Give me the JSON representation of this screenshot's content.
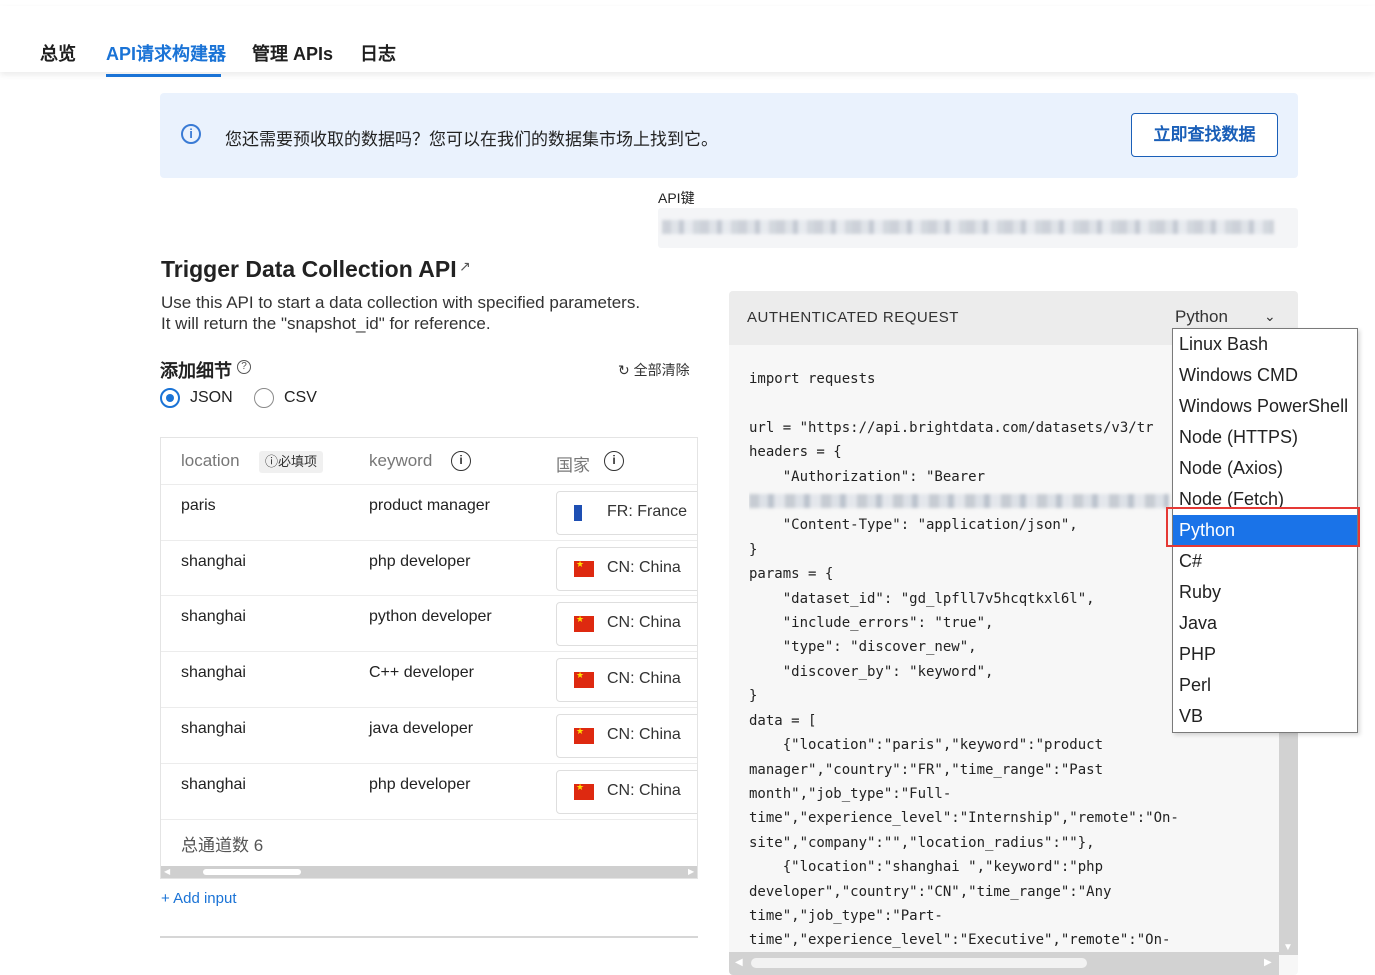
{
  "tabs": {
    "overview": "总览",
    "builder": "API请求构建器",
    "manage": "管理 APIs",
    "logs": "日志"
  },
  "banner": {
    "text": "您还需要预收取的数据吗？您可以在我们的数据集市场上找到它。",
    "button": "立即查找数据"
  },
  "api_key": {
    "label": "API键"
  },
  "section": {
    "title": "Trigger Data Collection API",
    "desc_line1": "Use this API to start a data collection with specified parameters.",
    "desc_line2": "It will return the \"snapshot_id\" for reference."
  },
  "details": {
    "title": "添加细节",
    "clear_all": "全部清除",
    "format_json": "JSON",
    "format_csv": "CSV",
    "selected_format": "JSON"
  },
  "table": {
    "headers": {
      "location": "location",
      "required": "必填项",
      "keyword": "keyword",
      "country": "国家"
    },
    "rows": [
      {
        "location": "paris",
        "keyword": "product manager",
        "country": "FR: France",
        "flag": "fr"
      },
      {
        "location": "shanghai",
        "keyword": "php developer",
        "country": "CN: China",
        "flag": "cn"
      },
      {
        "location": "shanghai",
        "keyword": "python developer",
        "country": "CN: China",
        "flag": "cn"
      },
      {
        "location": "shanghai",
        "keyword": "C++ developer",
        "country": "CN: China",
        "flag": "cn"
      },
      {
        "location": "shanghai",
        "keyword": "java developer",
        "country": "CN: China",
        "flag": "cn"
      },
      {
        "location": "shanghai",
        "keyword": "php developer",
        "country": "CN: China",
        "flag": "cn"
      }
    ],
    "total": "总通道数 6"
  },
  "add_input": "+ Add input",
  "code_panel": {
    "header": "AUTHENTICATED REQUEST",
    "language": "Python",
    "lines": {
      "l1": "import requests",
      "l2": "",
      "l3": "url = \"https://api.brightdata.com/datasets/v3/tr",
      "l4": "headers = {",
      "l5": "    \"Authorization\": \"Bearer",
      "l7": "    \"Content-Type\": \"application/json\",",
      "l8": "}",
      "l9": "params = {",
      "l10": "    \"dataset_id\": \"gd_lpfll7v5hcqtkxl6l\",",
      "l11": "    \"include_errors\": \"true\",",
      "l12": "    \"type\": \"discover_new\",",
      "l13": "    \"discover_by\": \"keyword\",",
      "l14": "}",
      "l15": "data = [",
      "l16": "    {\"location\":\"paris\",\"keyword\":\"product",
      "l17": "manager\",\"country\":\"FR\",\"time_range\":\"Past",
      "l18": "month\",\"job_type\":\"Full-",
      "l19": "time\",\"experience_level\":\"Internship\",\"remote\":\"On-",
      "l20": "site\",\"company\":\"\",\"location_radius\":\"\"},",
      "l21": "    {\"location\":\"shanghai \",\"keyword\":\"php",
      "l22": "developer\",\"country\":\"CN\",\"time_range\":\"Any",
      "l23": "time\",\"job_type\":\"Part-",
      "l24": "time\",\"experience_level\":\"Executive\",\"remote\":\"On-"
    }
  },
  "language_dropdown": {
    "options": [
      "Linux Bash",
      "Windows CMD",
      "Windows PowerShell",
      "Node (HTTPS)",
      "Node (Axios)",
      "Node (Fetch)",
      "Python",
      "C#",
      "Ruby",
      "Java",
      "PHP",
      "Perl",
      "VB"
    ],
    "selected": "Python"
  },
  "colors": {
    "accent": "#1a73d6",
    "dropdown_selected": "#1a73e8",
    "highlight": "#e53935",
    "banner_bg": "#eaf2fd"
  }
}
